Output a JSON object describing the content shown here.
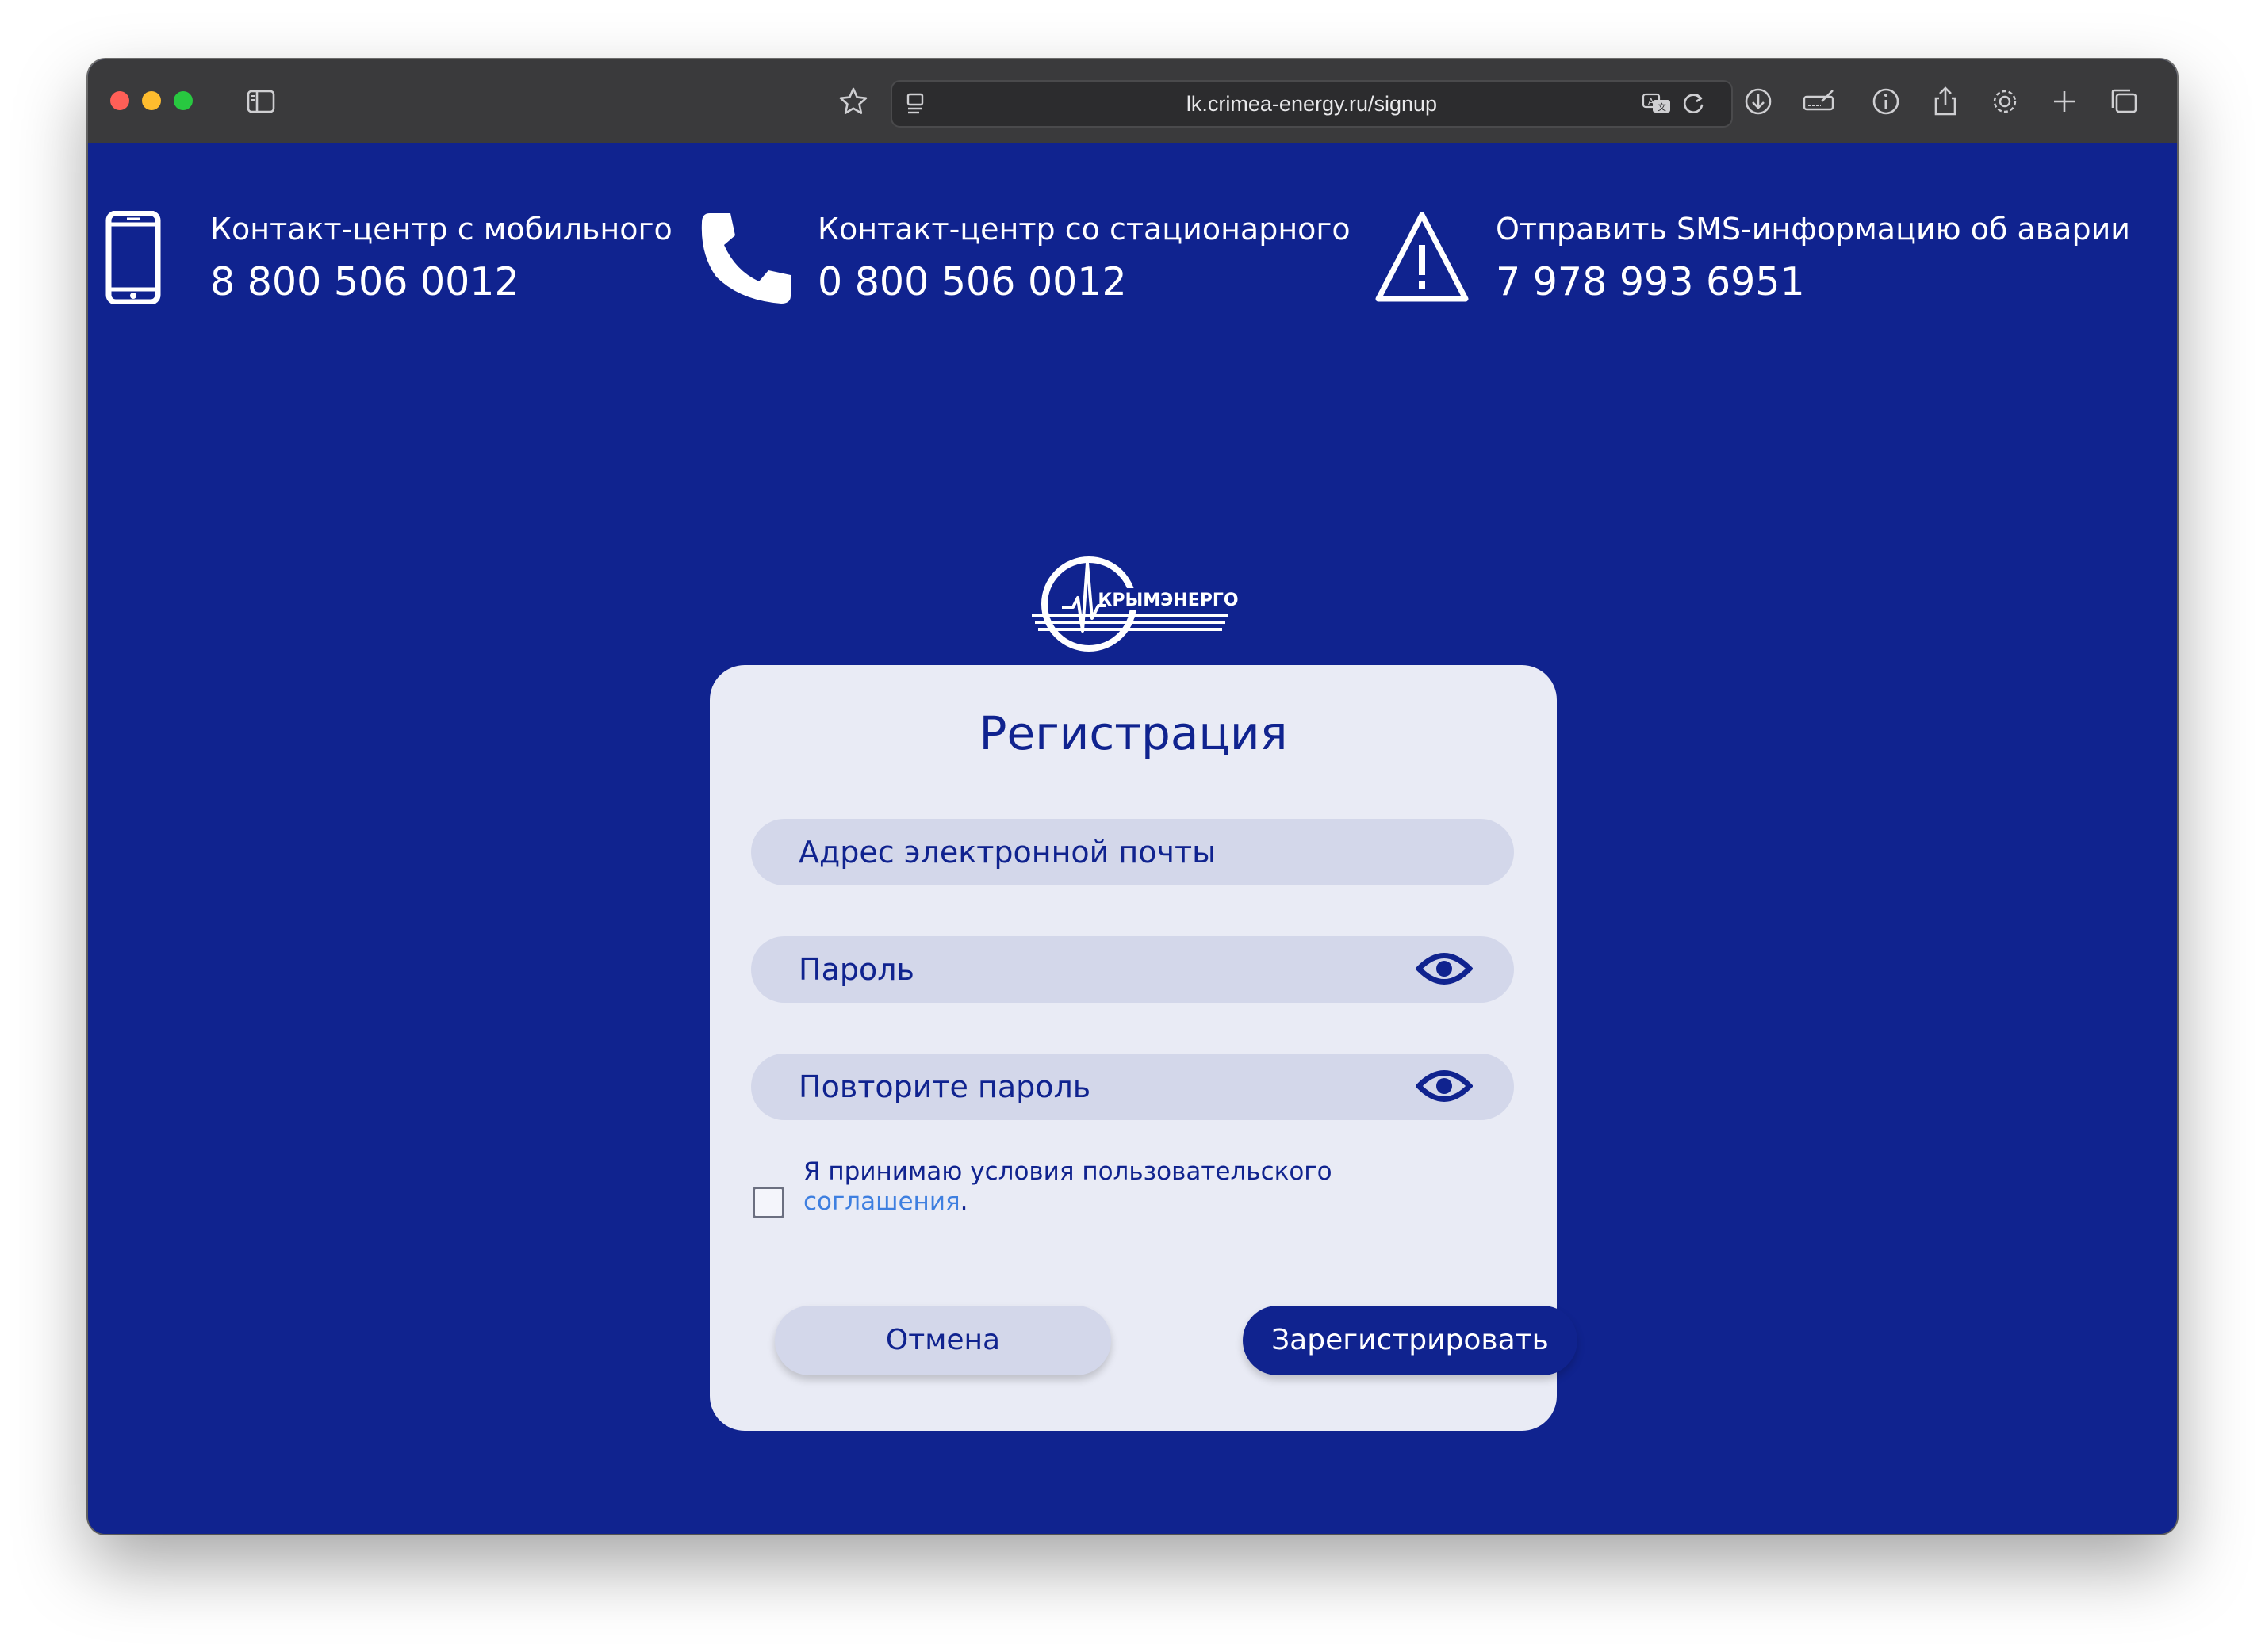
{
  "browser": {
    "url": "lk.crimea-energy.ru/signup",
    "icons": {
      "sidebar": "sidebar-icon",
      "bookmark": "star-icon",
      "reader": "reader-icon",
      "translate": "translate-icon",
      "reload": "reload-icon",
      "download": "download-icon",
      "extensions": "extensions-icon",
      "info": "info-icon",
      "share": "share-icon",
      "settings": "gear-icon",
      "new_tab": "plus-icon",
      "tabs": "tabs-icon"
    }
  },
  "contacts": [
    {
      "title": "Контакт-центр с мобильного",
      "phone": "8 800 506 0012",
      "icon": "mobile-phone-icon"
    },
    {
      "title": "Контакт-центр со стационарного",
      "phone": "0 800 506 0012",
      "icon": "telephone-handset-icon"
    },
    {
      "title": "Отправить SMS-информацию об аварии",
      "phone": "7 978 993 6951",
      "icon": "warning-triangle-icon"
    }
  ],
  "logo": {
    "text": "КРЫМЭНЕРГО"
  },
  "form": {
    "title": "Регистрация",
    "email_placeholder": "Адрес электронной почты",
    "password_placeholder": "Пароль",
    "repeat_password_placeholder": "Повторите пароль",
    "consent_text": "Я принимаю условия пользовательского",
    "consent_link": "соглашения",
    "consent_period": ".",
    "consent_checked": false,
    "cancel_label": "Отмена",
    "submit_label": "Зарегистрировать"
  },
  "colors": {
    "page_background": "#10238f",
    "card_background": "#e9ebf5",
    "field_background": "#d3d7ea",
    "accent": "#10238f",
    "link": "#3e7fe0"
  }
}
